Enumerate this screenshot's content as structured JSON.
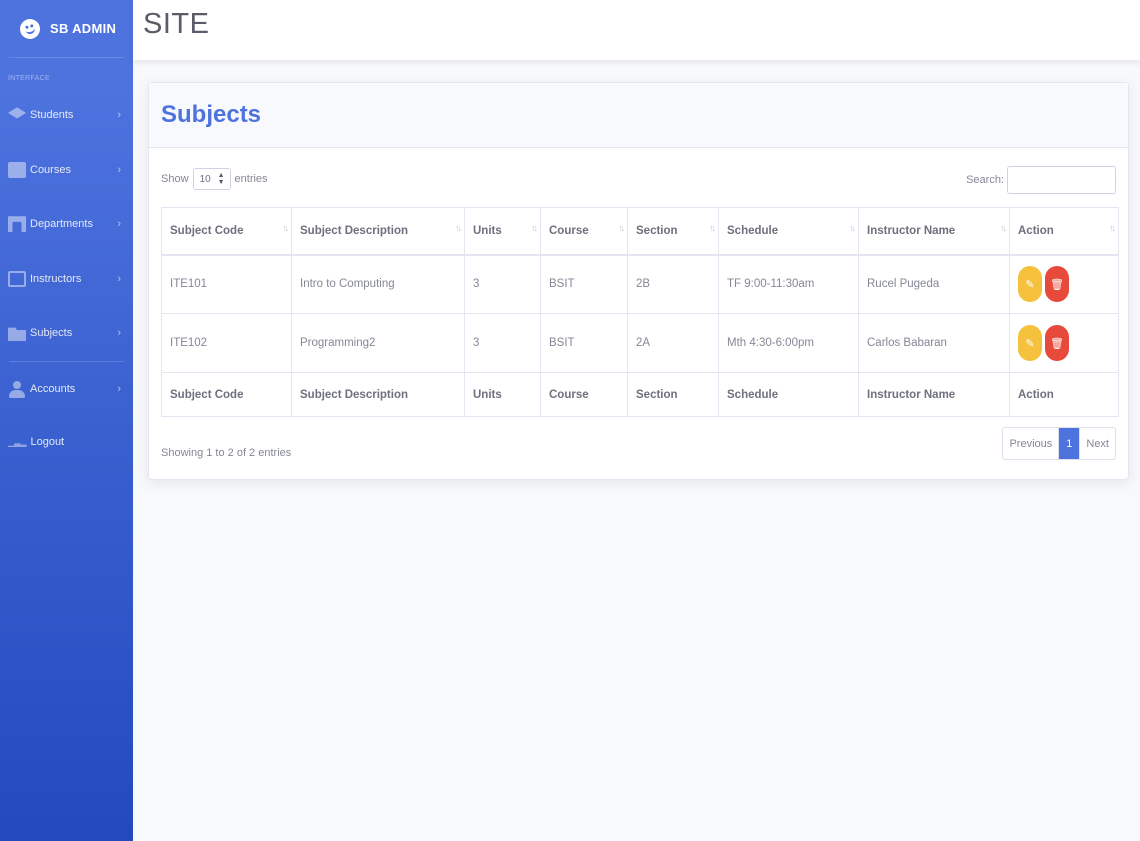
{
  "sidebar": {
    "brand": "SB ADMIN",
    "heading": "INTERFACE",
    "items": [
      {
        "label": "Students",
        "icon": "graduation-cap-icon"
      },
      {
        "label": "Courses",
        "icon": "book-icon"
      },
      {
        "label": "Departments",
        "icon": "archway-icon"
      },
      {
        "label": "Instructors",
        "icon": "chalkboard-teacher-icon"
      },
      {
        "label": "Subjects",
        "icon": "folder-open-icon"
      },
      {
        "label": "Accounts",
        "icon": "user-icon"
      }
    ],
    "logout": "Logout",
    "accent_color": "#4e73df"
  },
  "topbar": {
    "title": "SITE"
  },
  "card": {
    "title": "Subjects",
    "show_label": "Show",
    "entries_label": "entries",
    "page_length": "10",
    "search_label": "Search:",
    "search_value": "",
    "columns": [
      "Subject Code",
      "Subject Description",
      "Units",
      "Course",
      "Section",
      "Schedule",
      "Instructor Name",
      "Action"
    ],
    "rows": [
      [
        "ITE101",
        "Intro to Computing",
        "3",
        "BSIT",
        "2B",
        "TF 9:00-11:30am",
        "Rucel Pugeda"
      ],
      [
        "ITE102",
        "Programming2",
        "3",
        "BSIT",
        "2A",
        "Mth 4:30-6:00pm",
        "Carlos Babaran"
      ]
    ],
    "info": "Showing 1 to 2 of 2 entries",
    "pagination": {
      "previous": "Previous",
      "current": "1",
      "next": "Next"
    },
    "edit_color": "#f6c23e",
    "delete_color": "#e74a3b"
  }
}
